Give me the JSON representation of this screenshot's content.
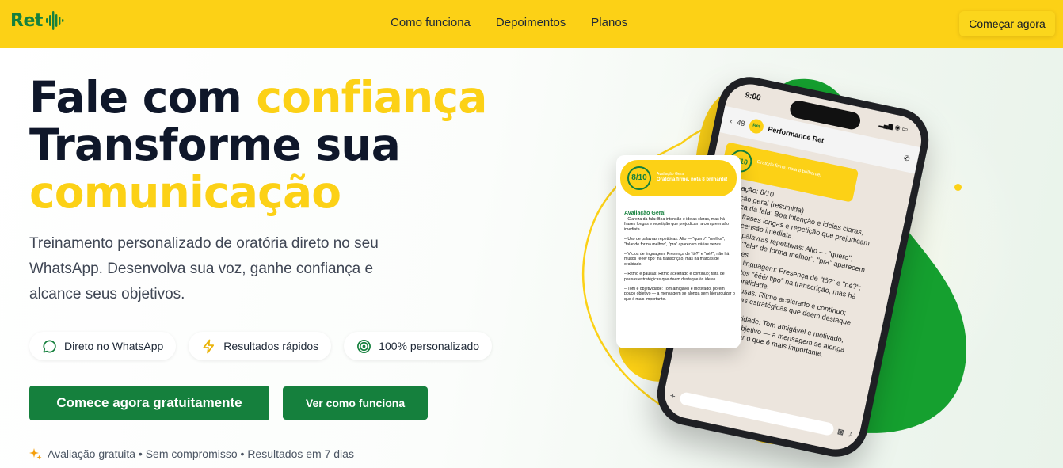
{
  "nav": {
    "logo_text": "Ret",
    "links": [
      "Como funciona",
      "Depoimentos",
      "Planos"
    ],
    "cta": "Começar agora"
  },
  "hero": {
    "title_line1_a": "Fale com ",
    "title_line1_b": "confiança",
    "title_line2": "Transforme sua",
    "title_line3": "comunicação",
    "subtitle": "Treinamento personalizado de oratória direto no seu WhatsApp. Desenvolva sua voz, ganhe confiança e alcance seus objetivos.",
    "features": [
      {
        "label": "Direto no WhatsApp",
        "icon": "chat-bubble-icon"
      },
      {
        "label": "Resultados rápidos",
        "icon": "lightning-icon"
      },
      {
        "label": "100% personalizado",
        "icon": "target-icon"
      }
    ],
    "primary_cta": "Comece agora gratuitamente",
    "secondary_cta": "Ver como funciona",
    "trust_line": "Avaliação gratuita • Sem compromisso • Resultados em 7 dias",
    "trust_icon": "sparkles-icon"
  },
  "phone": {
    "time": "9:00",
    "back_count": "48",
    "contact_name": "Performance Ret",
    "avatar_text": "Ret",
    "score": "8/10",
    "card_caption": "Oratória firme, nota 8 brilhante!",
    "body": [
      "Pontuação: 8/10",
      "Avaliação geral (resumida)",
      "• Clareza da fala: Boa intenção e ideias claras, mas há frases longas e repetição que prejudicam a compreensão imediata.",
      "• Uso de palavras repetitivas: Alto — \"quero\", \"melhor\", \"falar de forma melhor\", \"pra\" aparecem várias vezes.",
      "• Vícios de linguagem: Presença de \"tô?\" e \"né?\"; não há muitos \"ééé/ tipo\" na transcrição, mas há marcas de oralidade.",
      "• Ritmo e pausas: Ritmo acelerado e contínuo; falta de pausas estratégicas que deem destaque às ideias.",
      "• Tom e objetividade: Tom amigável e motivado, porém pouco objetivo — a mensagem se alonga sem hierarquizar o que é mais importante."
    ]
  },
  "eval_card": {
    "score": "8/10",
    "caption": "Avaliação Geral",
    "headline": "Oratória firme, nota 8 brilhante!",
    "title": "Avaliação Geral",
    "items": [
      "– Clareza da fala: Boa intenção e ideias claras, mas há frases longas e repetição que prejudicam a compreensão imediata.",
      "– Uso de palavras repetitivas: Alto — \"quero\", \"melhor\", \"falar de forma melhor\", \"pra\" aparecem várias vezes.",
      "– Vícios de linguagem: Presença de \"tô?\" e \"né?\"; não há muitos \"ééé/ tipo\" na transcrição, mas há marcas de oralidade.",
      "– Ritmo e pausas: Ritmo acelerado e contínuo; falta de pausas estratégicas que deem destaque às ideias.",
      "– Tom e objetividade: Tom amigável e motivado, porém pouco objetivo — a mensagem se alonga sem hierarquizar o que é mais importante."
    ]
  },
  "colors": {
    "brand_yellow": "#fcd116",
    "brand_green": "#15803d",
    "text_dark": "#0f172a"
  }
}
